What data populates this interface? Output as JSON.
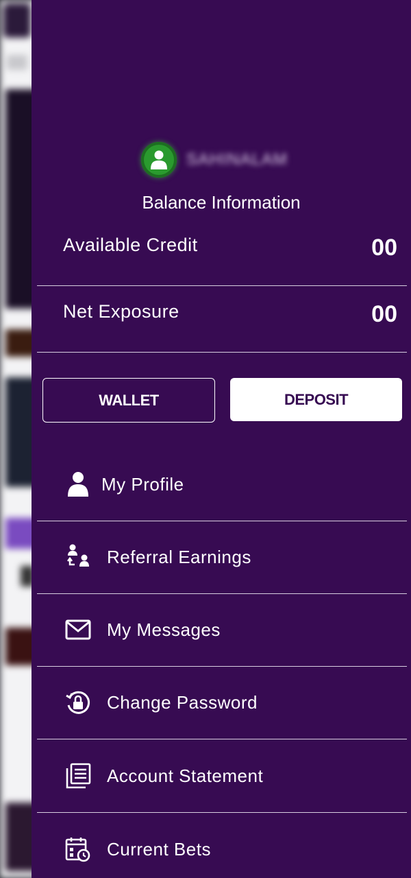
{
  "user": {
    "name": "SAHINALAM"
  },
  "balance": {
    "title": "Balance Information",
    "rows": [
      {
        "label": "Available Credit",
        "value": "00"
      },
      {
        "label": "Net Exposure",
        "value": "00"
      }
    ]
  },
  "actions": {
    "wallet_label": "WALLET",
    "deposit_label": "DEPOSIT"
  },
  "menu": {
    "items": [
      {
        "label": "My Profile",
        "icon": "user-icon"
      },
      {
        "label": "Referral Earnings",
        "icon": "referral-icon"
      },
      {
        "label": "My Messages",
        "icon": "envelope-icon"
      },
      {
        "label": "Change Password",
        "icon": "lock-reset-icon"
      },
      {
        "label": "Account Statement",
        "icon": "statement-icon"
      },
      {
        "label": "Current Bets",
        "icon": "bets-calendar-icon"
      }
    ]
  },
  "colors": {
    "drawer_bg": "#370b52",
    "avatar_green": "#2a9a2e",
    "text": "#ffffff"
  }
}
